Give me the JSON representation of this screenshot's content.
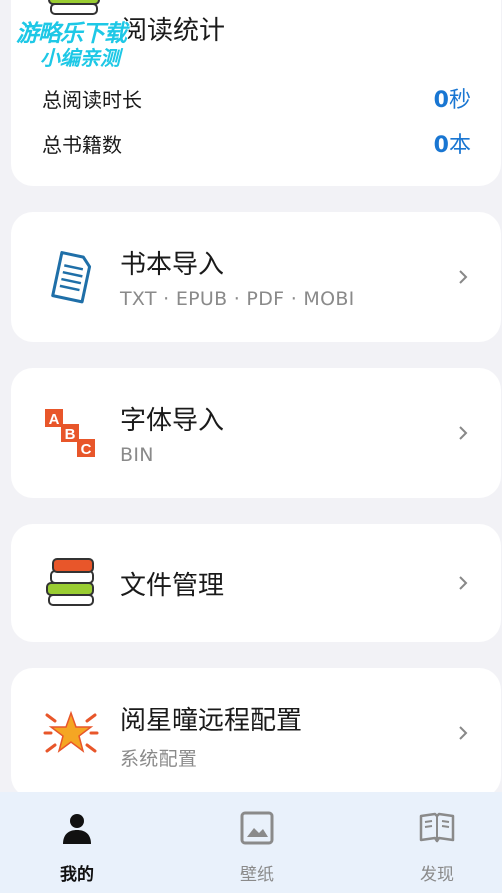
{
  "stats": {
    "title": "阅读统计",
    "rows": [
      {
        "label": "总阅读时长",
        "value": "0",
        "unit": "秒"
      },
      {
        "label": "总书籍数",
        "value": "0",
        "unit": "本"
      }
    ],
    "watermark": {
      "line1": "游略乐下载",
      "line2": "小编亲测"
    }
  },
  "menu": [
    {
      "title": "书本导入",
      "subtitle": "TXT · EPUB · PDF · MOBI",
      "icon": "document-icon"
    },
    {
      "title": "字体导入",
      "subtitle": "BIN",
      "icon": "abc-blocks-icon"
    },
    {
      "title": "文件管理",
      "subtitle": "",
      "icon": "books-stack-icon"
    },
    {
      "title": "阅星曈远程配置",
      "subtitle": "系统配置",
      "icon": "star-burst-icon"
    }
  ],
  "tabs": [
    {
      "label": "我的",
      "icon": "person-icon",
      "active": true
    },
    {
      "label": "壁纸",
      "icon": "image-icon",
      "active": false
    },
    {
      "label": "发现",
      "icon": "open-book-icon",
      "active": false
    }
  ],
  "colors": {
    "accent": "#1976d2",
    "background": "#f2f2f6",
    "tabbar": "#e9f1fb"
  }
}
